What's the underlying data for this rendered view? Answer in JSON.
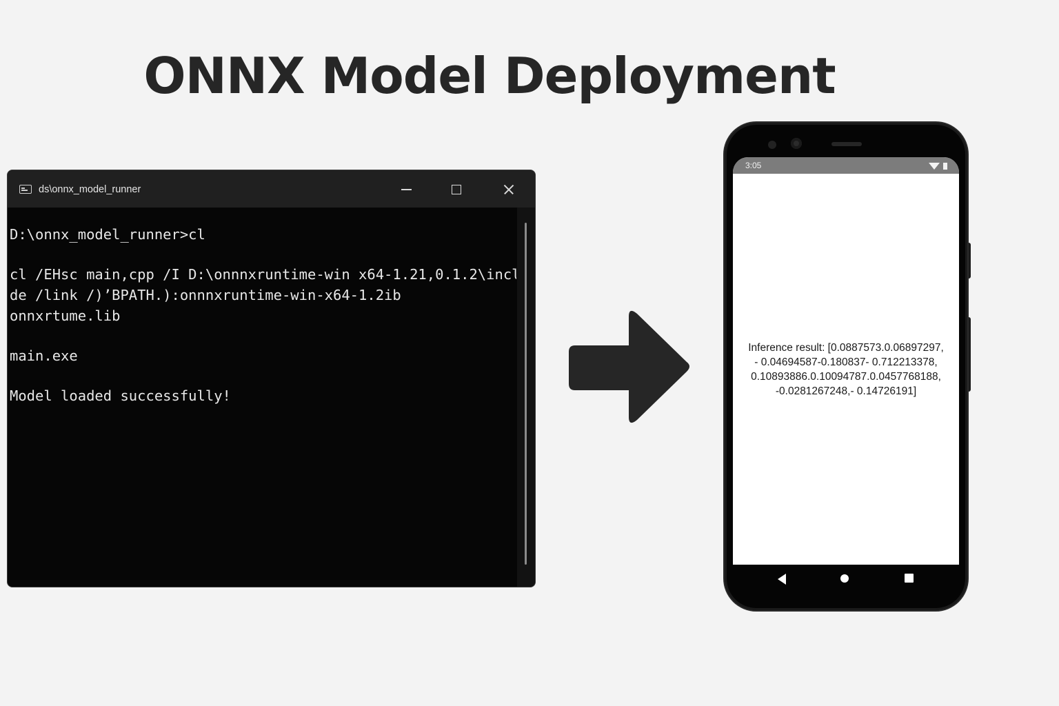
{
  "title": "ONNX Model Deployment",
  "terminal": {
    "window_title": "ds\\onnx_model_runner",
    "lines": [
      "D:\\onnx_model_runner>cl",
      "",
      "cl /EHsc main,cpp /I D:\\onnnxruntime-win x64-1.21,0.1.2\\incl",
      "de /link /)’BPATH.):onnnxruntime-win-x64-1.2ib",
      "onnxrtume.lib",
      "",
      "main.exe",
      "",
      "Model loaded successfully!"
    ]
  },
  "phone": {
    "status_time": "3:05",
    "inference_lines": [
      "Inference result: [0.0887573.0.06897297,",
      "- 0.04694587-0.180837- 0.712213378,",
      "0.10893886.0.10094787.0.0457768188,",
      "-0.0281267248,- 0.14726191]"
    ]
  },
  "colors": {
    "page_background": "#f3f3f3",
    "title_text": "#262626",
    "terminal_background": "#060606",
    "terminal_titlebar": "#202020",
    "terminal_text": "#e8e8e8",
    "arrow": "#262626",
    "phone_body": "#050505",
    "phone_status_bar": "#7c7c7c"
  },
  "icons": [
    "terminal-app-icon",
    "minimize-icon",
    "maximize-icon",
    "close-icon",
    "right-arrow-icon",
    "wifi-icon",
    "battery-icon",
    "back-icon",
    "home-icon",
    "recents-icon"
  ]
}
